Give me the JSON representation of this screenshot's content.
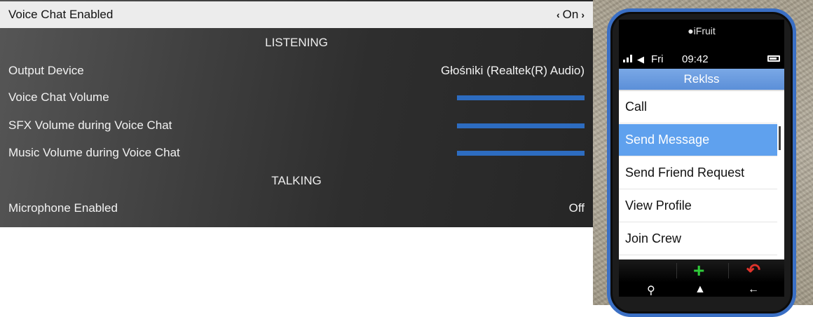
{
  "settings": {
    "voice_chat": {
      "label": "Voice Chat Enabled",
      "value": "On",
      "left_arrow": "‹",
      "right_arrow": "›"
    },
    "section_listening": "LISTENING",
    "output_device": {
      "label": "Output Device",
      "value": "Głośniki (Realtek(R) Audio)"
    },
    "voice_volume": {
      "label": "Voice Chat Volume",
      "level": 1.0
    },
    "sfx_volume": {
      "label": "SFX Volume during Voice Chat",
      "level": 1.0
    },
    "music_volume": {
      "label": "Music Volume during Voice Chat",
      "level": 1.0
    },
    "section_talking": "TALKING",
    "microphone": {
      "label": "Microphone Enabled",
      "value": "Off"
    },
    "accent_color": "#2d6cc0"
  },
  "phone": {
    "brand": "iFruit",
    "status": {
      "day": "Fri",
      "time": "09:42"
    },
    "contact_name": "Reklss",
    "menu": [
      {
        "label": "Call"
      },
      {
        "label": "Send Message"
      },
      {
        "label": "Send Friend Request"
      },
      {
        "label": "View Profile"
      },
      {
        "label": "Join Crew"
      }
    ],
    "selected_index": 1,
    "softkeys": {
      "select_icon": "plus-icon",
      "back_icon": "undo-arrow-icon"
    },
    "navbar_icons": [
      "search-icon",
      "home-icon",
      "back-arrow-icon"
    ],
    "frame_color": "#3a6fc4",
    "highlight_color": "#5fa1ee"
  }
}
